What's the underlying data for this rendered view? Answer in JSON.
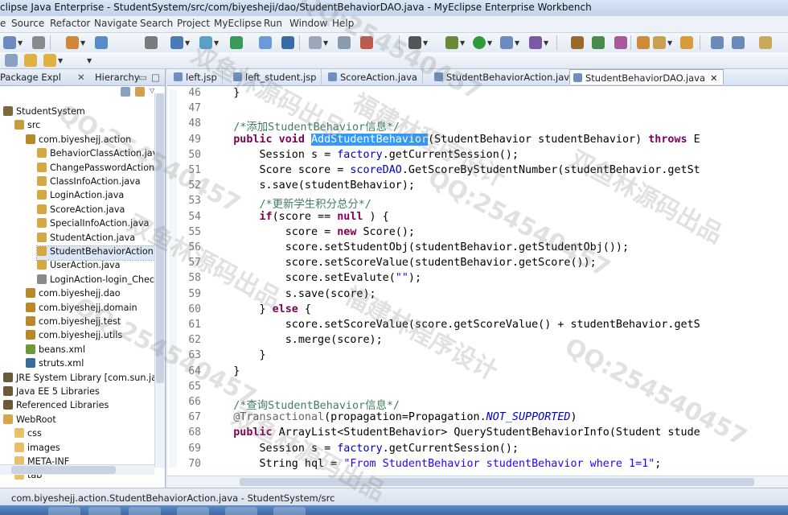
{
  "window": {
    "title": "clipse Java Enterprise - StudentSystem/src/com/biyesheji/dao/StudentBehaviorDAO.java - MyEclipse Enterprise Workbench"
  },
  "menu": [
    "e",
    "Source",
    "Refactor",
    "Navigate",
    "Search",
    "Project",
    "MyEclipse",
    "Run",
    "Window",
    "Help"
  ],
  "left_tabs": {
    "package_explorer": "Package Expl",
    "hierarchy": "Hierarchy"
  },
  "tree": [
    {
      "label": "StudentSystem",
      "indent": 0,
      "icon": "project-icon",
      "color": "#7a6b3a"
    },
    {
      "label": "src",
      "indent": 1,
      "icon": "source-folder-icon",
      "color": "#c89b3c"
    },
    {
      "label": "com.biyeshejj.action",
      "indent": 2,
      "icon": "package-icon",
      "color": "#b8892a"
    },
    {
      "label": "BehaviorClassAction.java",
      "indent": 3,
      "icon": "java-file-icon",
      "color": "#d4a843"
    },
    {
      "label": "ChangePasswordAction.j",
      "indent": 3,
      "icon": "java-file-icon",
      "color": "#d4a843"
    },
    {
      "label": "ClassInfoAction.java",
      "indent": 3,
      "icon": "java-file-icon",
      "color": "#d4a843"
    },
    {
      "label": "LoginAction.java",
      "indent": 3,
      "icon": "java-file-icon",
      "color": "#d4a843"
    },
    {
      "label": "ScoreAction.java",
      "indent": 3,
      "icon": "java-file-icon",
      "color": "#d4a843"
    },
    {
      "label": "SpecialInfoAction.java",
      "indent": 3,
      "icon": "java-file-icon",
      "color": "#d4a843"
    },
    {
      "label": "StudentAction.java",
      "indent": 3,
      "icon": "java-file-icon",
      "color": "#d4a843"
    },
    {
      "label": "StudentBehaviorAction.ja",
      "indent": 3,
      "icon": "java-file-icon",
      "color": "#d4a843",
      "selected": true
    },
    {
      "label": "UserAction.java",
      "indent": 3,
      "icon": "java-file-icon",
      "color": "#d4a843"
    },
    {
      "label": "LoginAction-login_Check",
      "indent": 3,
      "icon": "xml-file-icon",
      "color": "#8a8a8a"
    },
    {
      "label": "com.biyeshejj.dao",
      "indent": 2,
      "icon": "package-icon",
      "color": "#b8892a"
    },
    {
      "label": "com.biyeshejj.domain",
      "indent": 2,
      "icon": "package-icon",
      "color": "#b8892a"
    },
    {
      "label": "com.biyeshejj.test",
      "indent": 2,
      "icon": "package-icon",
      "color": "#b8892a"
    },
    {
      "label": "com.biyeshejj.utils",
      "indent": 2,
      "icon": "package-icon",
      "color": "#b8892a"
    },
    {
      "label": "beans.xml",
      "indent": 2,
      "icon": "xml-file-icon",
      "color": "#6a9a3a"
    },
    {
      "label": "struts.xml",
      "indent": 2,
      "icon": "struts-gear-icon",
      "color": "#3a6a9a"
    },
    {
      "label": "JRE System Library [com.sun.jav",
      "indent": 0,
      "icon": "library-icon",
      "color": "#6a5a3a"
    },
    {
      "label": "Java EE 5 Libraries",
      "indent": 0,
      "icon": "library-icon",
      "color": "#6a5a3a"
    },
    {
      "label": "Referenced Libraries",
      "indent": 0,
      "icon": "library-icon",
      "color": "#6a5a3a"
    },
    {
      "label": "WebRoot",
      "indent": 0,
      "icon": "folder-icon",
      "color": "#d6a64a"
    },
    {
      "label": "css",
      "indent": 1,
      "icon": "folder-icon",
      "color": "#e6c06a"
    },
    {
      "label": "images",
      "indent": 1,
      "icon": "folder-icon",
      "color": "#e6c06a"
    },
    {
      "label": "META-INF",
      "indent": 1,
      "icon": "folder-icon",
      "color": "#e6c06a"
    },
    {
      "label": "tab",
      "indent": 1,
      "icon": "folder-icon",
      "color": "#e6c06a"
    }
  ],
  "editor_tabs": [
    {
      "label": "left.jsp",
      "active": false
    },
    {
      "label": "left_student.jsp",
      "active": false
    },
    {
      "label": "ScoreAction.java",
      "active": false
    },
    {
      "label": "StudentBehaviorAction.java",
      "active": false
    },
    {
      "label": "StudentBehaviorDAO.java",
      "active": true
    }
  ],
  "code_lines": [
    {
      "n": "46",
      "html": "    }"
    },
    {
      "n": "47",
      "html": ""
    },
    {
      "n": "48",
      "html": "    <c>/*添加StudentBehavior信息*/</c>"
    },
    {
      "n": "49",
      "html": "    <k>public void</k> <sel>AddStudentBehavior</sel>(StudentBehavior studentBehavior) <k>throws</k> E"
    },
    {
      "n": "50",
      "html": "        Session s = <f>factory</f>.getCurrentSession();"
    },
    {
      "n": "51",
      "html": "        Score score = <f>scoreDAO</f>.GetScoreByStudentNumber(studentBehavior.getSt"
    },
    {
      "n": "52",
      "html": "        s.save(studentBehavior);"
    },
    {
      "n": "53",
      "html": "        <c>/*更新学生积分总分*/</c>"
    },
    {
      "n": "54",
      "html": "        <k>if</k>(score == <k>null</k> ) {"
    },
    {
      "n": "55",
      "html": "            score = <k>new</k> Score();"
    },
    {
      "n": "56",
      "html": "            score.setStudentObj(studentBehavior.getStudentObj());"
    },
    {
      "n": "57",
      "html": "            score.setScoreValue(studentBehavior.getScore());"
    },
    {
      "n": "58",
      "html": "            score.setEvalute(<s>\"\"</s>);"
    },
    {
      "n": "59",
      "html": "            s.save(score);"
    },
    {
      "n": "60",
      "html": "        } <k>else</k> {"
    },
    {
      "n": "61",
      "html": "            score.setScoreValue(score.getScoreValue() + studentBehavior.getS"
    },
    {
      "n": "62",
      "html": "            s.merge(score);"
    },
    {
      "n": "63",
      "html": "        }"
    },
    {
      "n": "64",
      "html": "    }"
    },
    {
      "n": "65",
      "html": ""
    },
    {
      "n": "66",
      "html": "    <c>/*查询StudentBehavior信息*/</c>"
    },
    {
      "n": "67",
      "html": "    <a>@Transactional</a>(propagation=Propagation.<i>NOT_SUPPORTED</i>)"
    },
    {
      "n": "68",
      "html": "    <k>public</k> ArrayList&lt;StudentBehavior&gt; QueryStudentBehaviorInfo(Student stude"
    },
    {
      "n": "69",
      "html": "        Session s = <f>factory</f>.getCurrentSession();"
    },
    {
      "n": "70",
      "html": "        String hql = <s>\"From StudentBehavior studentBehavior where 1=1\"</s>;"
    }
  ],
  "status": {
    "text": "com.biyeshejj.action.StudentBehaviorAction.java - StudentSystem/src"
  },
  "watermarks": [
    "QQ:254540457",
    "双鱼林源码出品",
    "福建林程序设计"
  ],
  "colors": {
    "keyword": "#7f0055",
    "comment": "#3f7f5f",
    "string": "#2a00ff",
    "field": "#0000c0",
    "annotation": "#646464",
    "selection": "#3399ff"
  }
}
